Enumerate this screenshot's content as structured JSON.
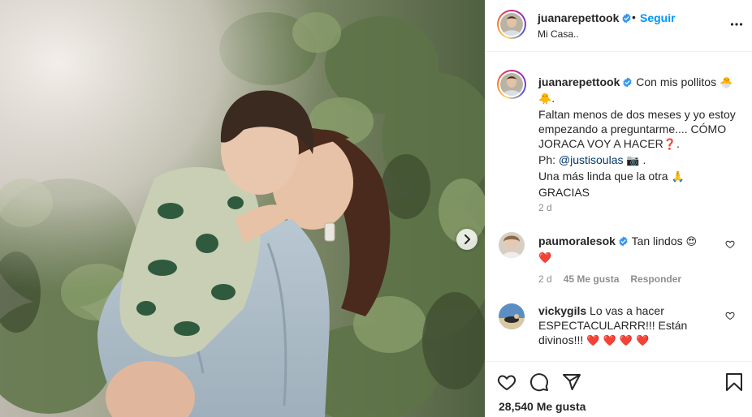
{
  "header": {
    "username": "juanarepettook",
    "bullet": "•",
    "follow_label": "Seguir",
    "location": "Mi Casa.."
  },
  "caption": {
    "username": "juanarepettook",
    "line1": "Con mis pollitos",
    "line1_emoji": "🐣",
    "line2_emoji": "🐥",
    "line2_end": ".",
    "line3": "Faltan menos de dos meses y yo estoy empezando a preguntarme.... CÓMO JORACA VOY A HACER",
    "line3_emoji": "❓",
    "line3_end": ".",
    "photo_credit_prefix": "Ph:",
    "photo_credit_mention": "@justisoulas",
    "photo_credit_emoji": "📷",
    "photo_credit_end": ".",
    "line5": "Una más linda que la otra",
    "line5_emoji": "🙏",
    "line6": "GRACIAS",
    "time": "2 d"
  },
  "comments": [
    {
      "username": "paumoralesok",
      "text": "Tan lindos",
      "emoji": "😍",
      "second_line": "❤️",
      "time": "2 d",
      "likes": "45 Me gusta",
      "reply": "Responder"
    },
    {
      "username": "vickygils",
      "text": "Lo vas a hacer ESPECTACULARRR!!! Están divinos!!!",
      "emoji": "❤️ ❤️ ❤️ ❤️"
    }
  ],
  "actions": {
    "likes_count": "28,540 Me gusta"
  },
  "icons": {
    "verified": "verified-badge-icon",
    "more": "more-options-icon",
    "next": "chevron-right-icon",
    "like": "heart-icon",
    "comment": "comment-icon",
    "share": "paper-plane-icon",
    "save": "bookmark-icon"
  },
  "colors": {
    "link_blue": "#0095f6",
    "verified_blue": "#3897f0",
    "mention": "#00376b",
    "muted": "#8e8e8e",
    "heart_red": "#ed4956"
  }
}
